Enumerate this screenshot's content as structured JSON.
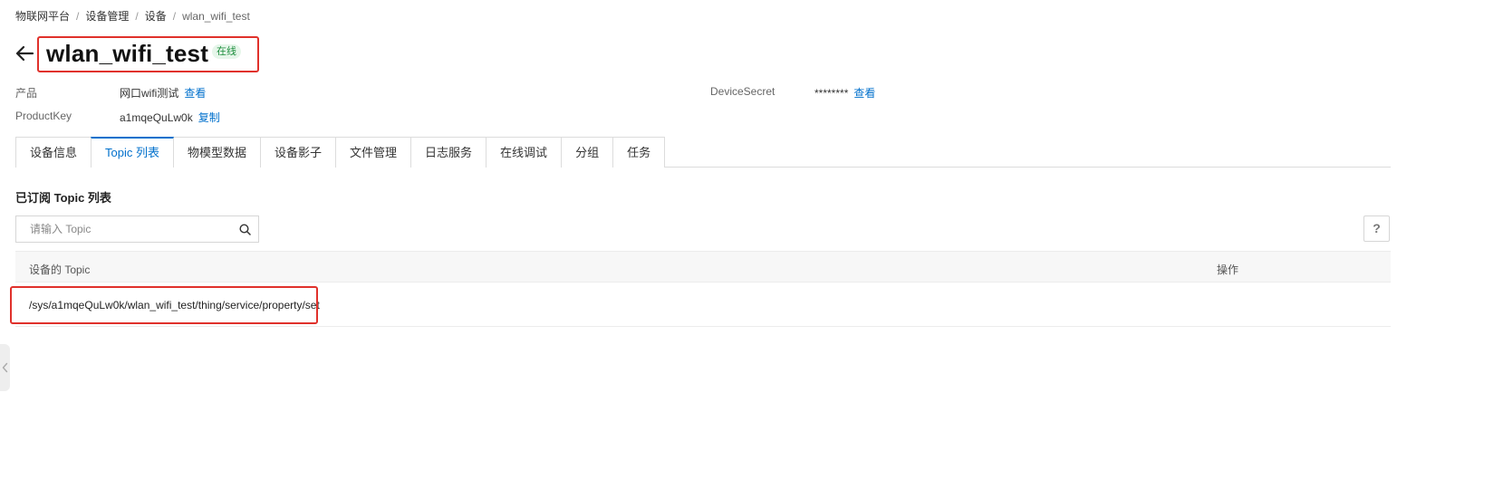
{
  "breadcrumb": {
    "items": [
      "物联网平台",
      "设备管理",
      "设备",
      "wlan_wifi_test"
    ],
    "separator": "/"
  },
  "header": {
    "title": "wlan_wifi_test",
    "status": "在线"
  },
  "meta": {
    "product_label": "产品",
    "product_value": "网口wifi测试",
    "product_link": "查看",
    "productkey_label": "ProductKey",
    "productkey_value": "a1mqeQuLw0k",
    "productkey_link": "复制",
    "secret_label": "DeviceSecret",
    "secret_value": "********",
    "secret_link": "查看"
  },
  "tabs": [
    {
      "label": "设备信息",
      "active": false
    },
    {
      "label": "Topic 列表",
      "active": true
    },
    {
      "label": "物模型数据",
      "active": false
    },
    {
      "label": "设备影子",
      "active": false
    },
    {
      "label": "文件管理",
      "active": false
    },
    {
      "label": "日志服务",
      "active": false
    },
    {
      "label": "在线调试",
      "active": false
    },
    {
      "label": "分组",
      "active": false
    },
    {
      "label": "任务",
      "active": false
    }
  ],
  "section": {
    "title": "已订阅 Topic 列表",
    "search_placeholder": "请输入 Topic",
    "help_label": "?"
  },
  "table": {
    "columns": [
      "设备的 Topic",
      "操作"
    ],
    "rows": [
      {
        "topic": "/sys/a1mqeQuLw0k/wlan_wifi_test/thing/service/property/set"
      }
    ]
  },
  "colors": {
    "accent": "#0070cc",
    "highlight": "#e0312b",
    "status_green": "#1e8e3e"
  },
  "icons": {
    "back": "arrow-left-icon",
    "search": "search-icon",
    "collapse": "chevron-left-icon"
  }
}
